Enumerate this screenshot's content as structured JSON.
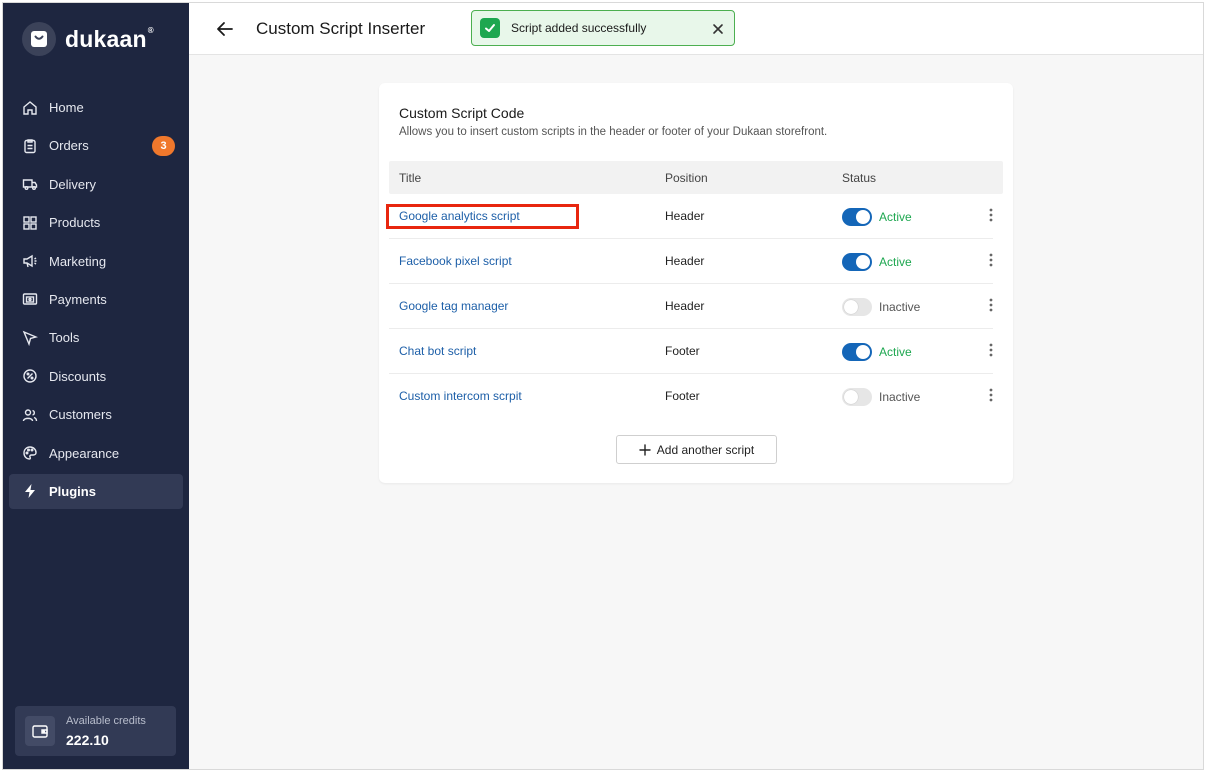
{
  "brand": {
    "name": "dukaan",
    "reg": "®"
  },
  "sidebar": {
    "items": [
      {
        "label": "Home",
        "icon": "home-icon"
      },
      {
        "label": "Orders",
        "icon": "clipboard-icon",
        "badge": "3"
      },
      {
        "label": "Delivery",
        "icon": "truck-icon"
      },
      {
        "label": "Products",
        "icon": "grid-icon"
      },
      {
        "label": "Marketing",
        "icon": "megaphone-icon"
      },
      {
        "label": "Payments",
        "icon": "payments-icon"
      },
      {
        "label": "Tools",
        "icon": "cursor-icon"
      },
      {
        "label": "Discounts",
        "icon": "discount-icon"
      },
      {
        "label": "Customers",
        "icon": "users-icon"
      },
      {
        "label": "Appearance",
        "icon": "palette-icon"
      },
      {
        "label": "Plugins",
        "icon": "bolt-icon",
        "active": true
      }
    ],
    "credits": {
      "label": "Available credits",
      "value": "222.10"
    }
  },
  "header": {
    "title": "Custom Script Inserter",
    "toast": "Script added successfully"
  },
  "card": {
    "title": "Custom Script Code",
    "subtitle": "Allows you to insert custom scripts in the header or footer of your Dukaan storefront.",
    "columns": {
      "title": "Title",
      "position": "Position",
      "status": "Status"
    },
    "rows": [
      {
        "title": "Google analytics script",
        "position": "Header",
        "status": "Active",
        "on": true
      },
      {
        "title": "Facebook pixel script",
        "position": "Header",
        "status": "Active",
        "on": true
      },
      {
        "title": "Google tag manager",
        "position": "Header",
        "status": "Inactive",
        "on": false
      },
      {
        "title": "Chat bot script",
        "position": "Footer",
        "status": "Active",
        "on": true
      },
      {
        "title": "Custom intercom scrpit",
        "position": "Footer",
        "status": "Inactive",
        "on": false
      }
    ],
    "add_label": "Add another script"
  },
  "colors": {
    "sidebar": "#1e2640",
    "accent": "#1466b8",
    "success": "#1ea750",
    "badge": "#f0782c",
    "highlight": "#e8260f"
  }
}
